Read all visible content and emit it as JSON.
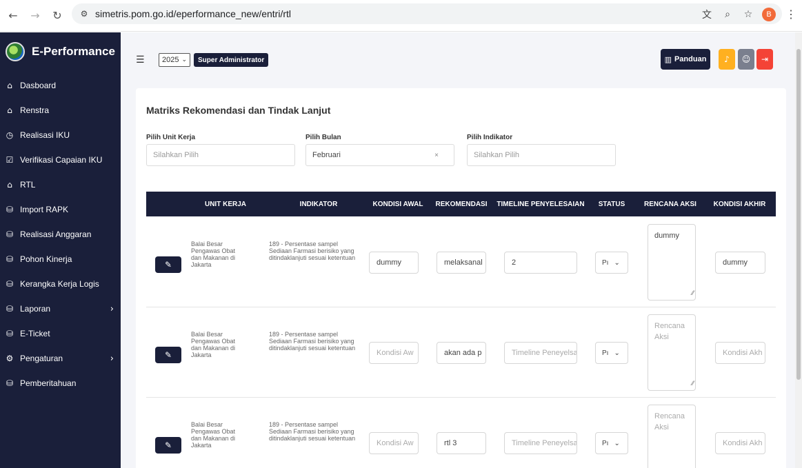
{
  "browser": {
    "url": "simetris.pom.go.id/eperformance_new/entri/rtl",
    "profile_initial": "B"
  },
  "sidebar": {
    "brand": "E-Performance",
    "items": [
      {
        "label": "Dasboard",
        "icon": "home-icon"
      },
      {
        "label": "Renstra",
        "icon": "home-icon"
      },
      {
        "label": "Realisasi IKU",
        "icon": "history-icon"
      },
      {
        "label": "Verifikasi Capaian IKU",
        "icon": "checkbox-icon"
      },
      {
        "label": "RTL",
        "icon": "home-icon"
      },
      {
        "label": "Import RAPK",
        "icon": "database-icon"
      },
      {
        "label": "Realisasi Anggaran",
        "icon": "database-icon"
      },
      {
        "label": "Pohon Kinerja",
        "icon": "database-icon"
      },
      {
        "label": "Kerangka Kerja Logis",
        "icon": "database-icon"
      },
      {
        "label": "Laporan",
        "icon": "database-icon"
      },
      {
        "label": "E-Ticket",
        "icon": "database-icon"
      },
      {
        "label": "Pengaturan",
        "icon": "gear-icon"
      },
      {
        "label": "Pemberitahuan",
        "icon": "database-icon"
      }
    ]
  },
  "topbar": {
    "year": "2025",
    "role": "Super Administrator",
    "panduan_label": "Panduan"
  },
  "card": {
    "title": "Matriks Rekomendasi dan Tindak Lanjut",
    "filters": {
      "unit_label": "Pilih Unit Kerja",
      "unit_placeholder": "Silahkan Pilih",
      "bulan_label": "Pilih Bulan",
      "bulan_value": "Februari",
      "clear": "×",
      "indikator_label": "Pilih Indikator",
      "indikator_placeholder": "Silahkan Pilih"
    }
  },
  "table": {
    "headers": [
      "UNIT KERJA",
      "INDIKATOR",
      "KONDISI AWAL",
      "REKOMENDASI",
      "TIMELINE PENYELESAIAN",
      "STATUS",
      "RENCANA AKSI",
      "KONDISI AKHIR"
    ],
    "rows": [
      {
        "unit_kerja": "Balai Besar Pengawas Obat dan Makanan di Jakarta",
        "indikator": "189 - Persentase sampel Sediaan Farmasi berisiko yang ditindaklanjuti sesuai ketentuan",
        "kondisi_awal": "dummy",
        "rekomendasi": "melaksanal",
        "timeline": "2",
        "status": "Pı",
        "rencana_aksi": "dummy",
        "kondisi_akhir": "dummy"
      },
      {
        "unit_kerja": "Balai Besar Pengawas Obat dan Makanan di Jakarta",
        "indikator": "189 - Persentase sampel Sediaan Farmasi berisiko yang ditindaklanjuti sesuai ketentuan",
        "kondisi_awal_ph": "Kondisi Aw",
        "rekomendasi": "akan ada p",
        "timeline_ph": "Timeline Peneyelsa",
        "status": "Pı",
        "rencana_aksi_ph": "Rencana Aksi",
        "kondisi_akhir_ph": "Kondisi Akh"
      },
      {
        "unit_kerja": "Balai Besar Pengawas Obat dan Makanan di Jakarta",
        "indikator": "189 - Persentase sampel Sediaan Farmasi berisiko yang ditindaklanjuti sesuai ketentuan",
        "kondisi_awal_ph": "Kondisi Aw",
        "rekomendasi": "rtl 3",
        "timeline_ph": "Timeline Peneyelsa",
        "status": "Pı",
        "rencana_aksi_ph": "Rencana Aksi",
        "kondisi_akhir_ph": "Kondisi Akh"
      }
    ]
  },
  "colors": {
    "navy": "#1a1f3a",
    "bell": "#ffb020",
    "user": "#7a7f8e",
    "logout": "#f44336"
  }
}
